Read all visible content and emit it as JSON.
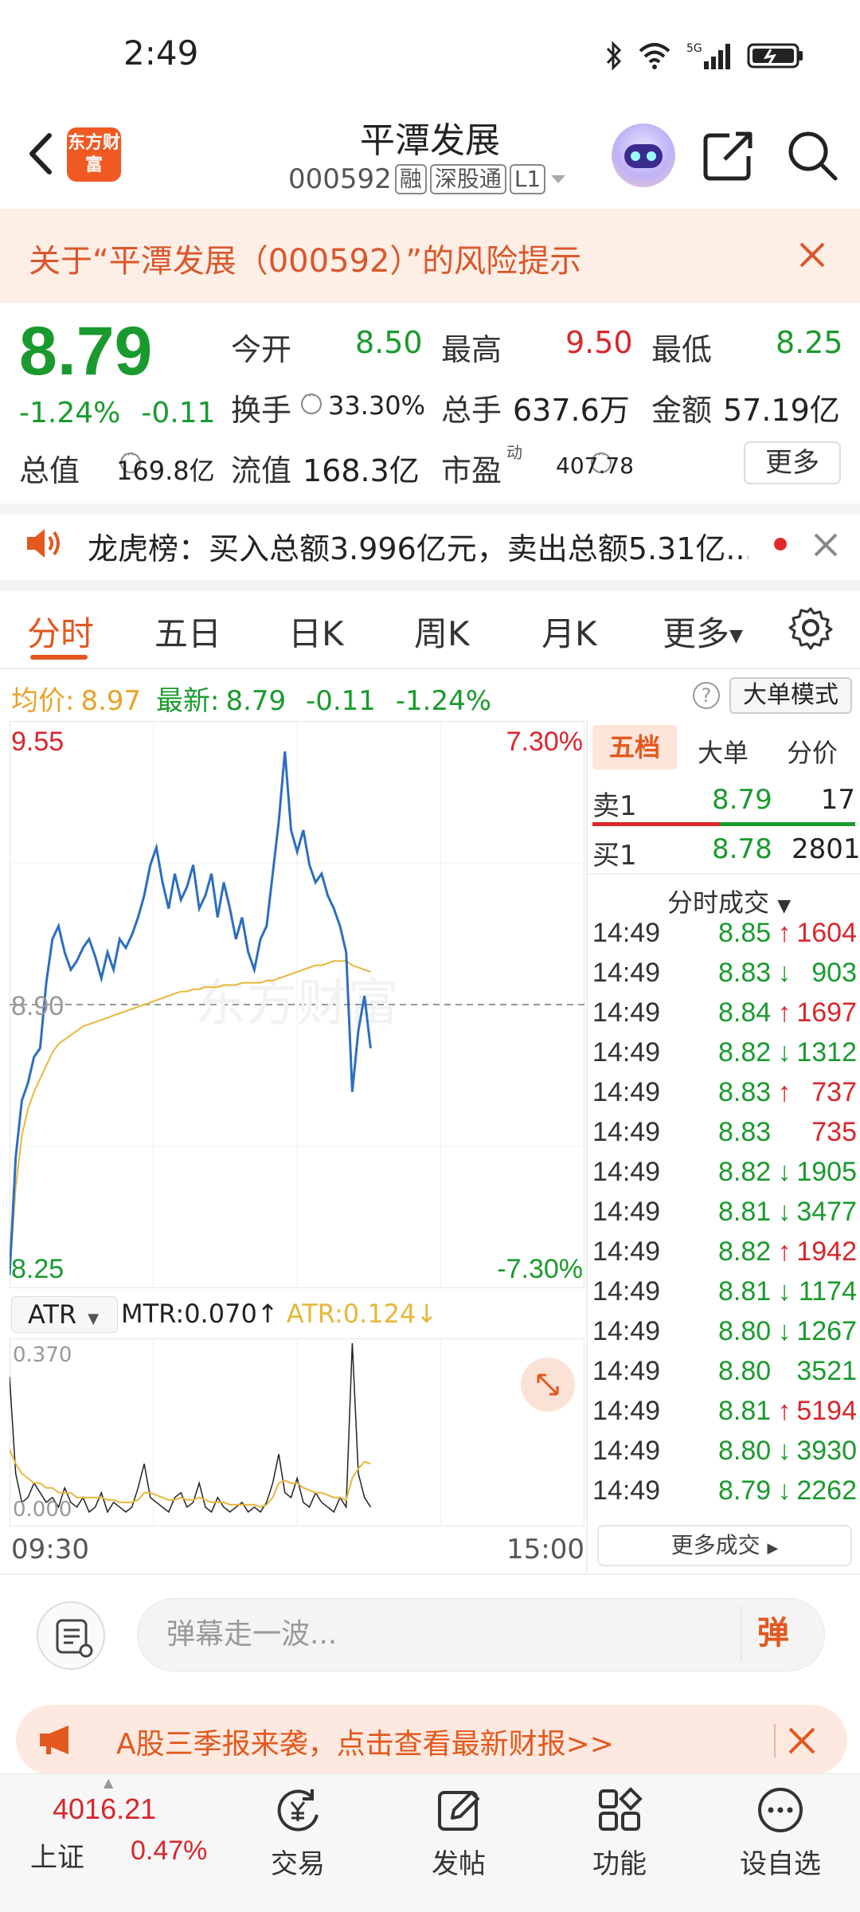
{
  "status_bar": {
    "time": "2:49"
  },
  "header": {
    "logo_text": "东方财富",
    "title": "平潭发展",
    "code": "000592",
    "tags": [
      "融",
      "深股通",
      "L1"
    ]
  },
  "risk_banner": {
    "text": "关于“平潭发展（000592）”的风险提示"
  },
  "quote": {
    "price": "8.79",
    "change_pct": "-1.24%",
    "change": "-0.11",
    "open_label": "今开",
    "open": "8.50",
    "high_label": "最高",
    "high": "9.50",
    "low_label": "最低",
    "low": "8.25",
    "turnover_label": "换手",
    "turnover": "33.30%",
    "volume_label": "总手",
    "volume": "637.6万",
    "amount_label": "金额",
    "amount": "57.19亿",
    "mktcap_label": "总值",
    "mktcap": "169.8亿",
    "float_label": "流值",
    "float_cap": "168.3亿",
    "pe_label": "市盈",
    "pe_sup": "动",
    "pe": "407.78",
    "more": "更多"
  },
  "dragon_tiger": {
    "text": "龙虎榜：买入总额3.996亿元，卖出总额5.31亿..."
  },
  "tabs": [
    "分时",
    "五日",
    "日K",
    "周K",
    "月K",
    "更多"
  ],
  "price_line": {
    "avg_label": "均价:",
    "avg": "8.97",
    "latest_label": "最新:",
    "latest": "8.79",
    "change": "-0.11",
    "change_pct": "-1.24%",
    "big_order_mode": "大单模式"
  },
  "chart_data": {
    "type": "line",
    "title": "",
    "y_top": "9.55",
    "y_mid": "8.90",
    "y_bottom": "8.25",
    "pct_top": "7.30%",
    "pct_bottom": "-7.30%",
    "x_start": "09:30",
    "x_end": "15:00",
    "ylim": [
      8.25,
      9.55
    ],
    "prev_close": 8.9,
    "series": [
      {
        "name": "price",
        "color": "#2c6ec1",
        "values": [
          8.28,
          8.55,
          8.68,
          8.72,
          8.78,
          8.8,
          8.95,
          9.05,
          9.08,
          9.02,
          8.98,
          9.0,
          9.03,
          9.05,
          9.01,
          8.96,
          9.02,
          8.98,
          9.05,
          9.03,
          9.06,
          9.1,
          9.15,
          9.22,
          9.26,
          9.18,
          9.12,
          9.2,
          9.14,
          9.17,
          9.22,
          9.12,
          9.15,
          9.2,
          9.1,
          9.18,
          9.12,
          9.05,
          9.1,
          9.02,
          8.98,
          9.05,
          9.08,
          9.2,
          9.32,
          9.48,
          9.3,
          9.25,
          9.3,
          9.22,
          9.18,
          9.2,
          9.15,
          9.12,
          9.08,
          9.02,
          8.7,
          8.84,
          8.92,
          8.8
        ]
      },
      {
        "name": "avg",
        "color": "#e8b73a",
        "values": [
          8.28,
          8.48,
          8.6,
          8.66,
          8.7,
          8.73,
          8.76,
          8.79,
          8.81,
          8.82,
          8.83,
          8.84,
          8.85,
          8.855,
          8.86,
          8.865,
          8.87,
          8.875,
          8.88,
          8.885,
          8.89,
          8.895,
          8.9,
          8.905,
          8.91,
          8.915,
          8.92,
          8.925,
          8.93,
          8.93,
          8.935,
          8.935,
          8.94,
          8.94,
          8.94,
          8.945,
          8.945,
          8.945,
          8.95,
          8.95,
          8.95,
          8.95,
          8.955,
          8.955,
          8.96,
          8.965,
          8.97,
          8.975,
          8.98,
          8.985,
          8.99,
          8.99,
          8.995,
          9.0,
          9.0,
          9.0,
          8.99,
          8.985,
          8.98,
          8.975
        ]
      }
    ]
  },
  "atr": {
    "name": "ATR",
    "mtr_label": "MTR:0.070",
    "atr_label": "ATR:0.124",
    "y_top": "0.370",
    "y_bottom": "0.000",
    "ylim": [
      0,
      0.37
    ],
    "mtr": [
      0.3,
      0.1,
      0.04,
      0.05,
      0.08,
      0.06,
      0.04,
      0.05,
      0.03,
      0.07,
      0.04,
      0.03,
      0.05,
      0.02,
      0.03,
      0.06,
      0.02,
      0.04,
      0.03,
      0.02,
      0.03,
      0.07,
      0.12,
      0.05,
      0.04,
      0.03,
      0.02,
      0.05,
      0.06,
      0.03,
      0.04,
      0.08,
      0.03,
      0.02,
      0.05,
      0.03,
      0.02,
      0.03,
      0.04,
      0.02,
      0.03,
      0.02,
      0.04,
      0.08,
      0.14,
      0.06,
      0.05,
      0.09,
      0.04,
      0.03,
      0.06,
      0.04,
      0.03,
      0.02,
      0.05,
      0.03,
      0.37,
      0.1,
      0.05,
      0.03
    ],
    "atr_line": [
      0.15,
      0.12,
      0.1,
      0.09,
      0.08,
      0.08,
      0.07,
      0.07,
      0.06,
      0.06,
      0.06,
      0.05,
      0.05,
      0.05,
      0.05,
      0.05,
      0.045,
      0.045,
      0.04,
      0.04,
      0.04,
      0.045,
      0.06,
      0.06,
      0.055,
      0.05,
      0.045,
      0.045,
      0.05,
      0.045,
      0.045,
      0.05,
      0.045,
      0.04,
      0.04,
      0.04,
      0.035,
      0.035,
      0.035,
      0.035,
      0.035,
      0.03,
      0.035,
      0.05,
      0.08,
      0.085,
      0.08,
      0.08,
      0.07,
      0.065,
      0.06,
      0.06,
      0.055,
      0.05,
      0.05,
      0.045,
      0.09,
      0.11,
      0.124,
      0.12
    ]
  },
  "order_book": {
    "tabs": [
      "五档",
      "大单",
      "分价"
    ],
    "sell": {
      "label": "卖1",
      "price": "8.79",
      "volume": "17"
    },
    "buy": {
      "label": "买1",
      "price": "8.78",
      "volume": "2801"
    }
  },
  "trades": {
    "header": "分时成交",
    "rows": [
      {
        "time": "14:49",
        "price": "8.85",
        "dir": "↑",
        "vol": "1604",
        "color": "#d9262b"
      },
      {
        "time": "14:49",
        "price": "8.83",
        "dir": "↓",
        "vol": "903",
        "color": "#1a9a2e"
      },
      {
        "time": "14:49",
        "price": "8.84",
        "dir": "↑",
        "vol": "1697",
        "color": "#d9262b"
      },
      {
        "time": "14:49",
        "price": "8.82",
        "dir": "↓",
        "vol": "1312",
        "color": "#1a9a2e"
      },
      {
        "time": "14:49",
        "price": "8.83",
        "dir": "↑",
        "vol": "737",
        "color": "#d9262b"
      },
      {
        "time": "14:49",
        "price": "8.83",
        "dir": "",
        "vol": "735",
        "color": "#d9262b"
      },
      {
        "time": "14:49",
        "price": "8.82",
        "dir": "↓",
        "vol": "1905",
        "color": "#1a9a2e"
      },
      {
        "time": "14:49",
        "price": "8.81",
        "dir": "↓",
        "vol": "3477",
        "color": "#1a9a2e"
      },
      {
        "time": "14:49",
        "price": "8.82",
        "dir": "↑",
        "vol": "1942",
        "color": "#d9262b"
      },
      {
        "time": "14:49",
        "price": "8.81",
        "dir": "↓",
        "vol": "1174",
        "color": "#1a9a2e"
      },
      {
        "time": "14:49",
        "price": "8.80",
        "dir": "↓",
        "vol": "1267",
        "color": "#1a9a2e"
      },
      {
        "time": "14:49",
        "price": "8.80",
        "dir": "",
        "vol": "3521",
        "color": "#1a9a2e"
      },
      {
        "time": "14:49",
        "price": "8.81",
        "dir": "↑",
        "vol": "5194",
        "color": "#d9262b"
      },
      {
        "time": "14:49",
        "price": "8.80",
        "dir": "↓",
        "vol": "3930",
        "color": "#1a9a2e"
      },
      {
        "time": "14:49",
        "price": "8.79",
        "dir": "↓",
        "vol": "2262",
        "color": "#1a9a2e"
      }
    ],
    "more": "更多成交"
  },
  "comment": {
    "placeholder": "弹幕走一波...",
    "danmu": "弹"
  },
  "promo": {
    "text": "A股三季报来袭，点击查看最新财报>>"
  },
  "bottom_nav": {
    "index_value": "4016.21",
    "index_name": "上证",
    "index_change": "0.47%",
    "items": [
      "交易",
      "发帖",
      "功能",
      "设自选"
    ]
  }
}
